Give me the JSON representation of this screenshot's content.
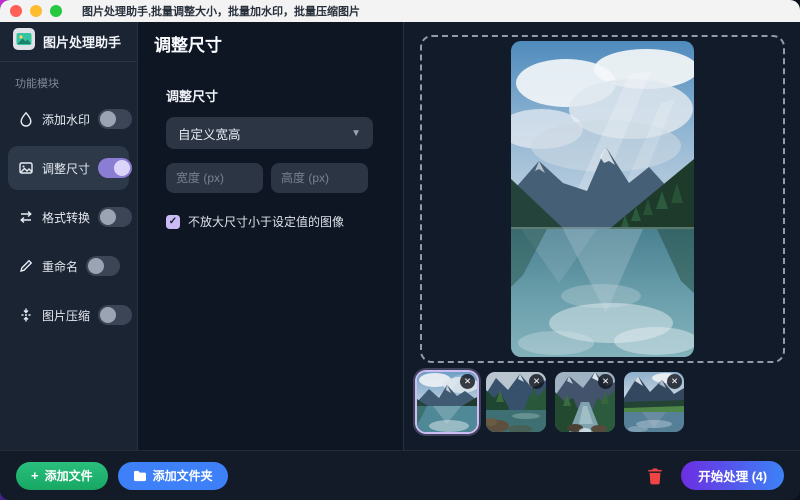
{
  "window": {
    "title": "图片处理助手,批量调整大小，批量加水印，批量压缩图片"
  },
  "sidebar": {
    "app_name": "图片处理助手",
    "section_label": "功能模块",
    "items": [
      {
        "label": "添加水印",
        "icon": "droplet-icon",
        "enabled": false
      },
      {
        "label": "调整尺寸",
        "icon": "image-icon",
        "enabled": true
      },
      {
        "label": "格式转换",
        "icon": "swap-arrows-icon",
        "enabled": false
      },
      {
        "label": "重命名",
        "icon": "pencil-icon",
        "enabled": false
      },
      {
        "label": "图片压缩",
        "icon": "compress-icon",
        "enabled": false
      }
    ]
  },
  "panel": {
    "header": "调整尺寸",
    "section_label": "调整尺寸",
    "mode_select": {
      "value": "自定义宽高",
      "icon": "chevron-down-icon"
    },
    "width_input": {
      "value": "",
      "placeholder": "宽度 (px)"
    },
    "height_input": {
      "value": "",
      "placeholder": "高度 (px)"
    },
    "checkbox": {
      "checked": true,
      "check_glyph": "✓",
      "label": "不放大尺寸小于设定值的图像"
    }
  },
  "preview": {
    "thumbnails": [
      {
        "name": "mountain-lake-blue",
        "selected": true,
        "close_glyph": "✕"
      },
      {
        "name": "forest-lake-green",
        "selected": false,
        "close_glyph": "✕"
      },
      {
        "name": "forest-stream",
        "selected": false,
        "close_glyph": "✕"
      },
      {
        "name": "meadow-lake",
        "selected": false,
        "close_glyph": "✕"
      }
    ]
  },
  "footer": {
    "add_files_label": "添加文件",
    "add_files_plus": "+",
    "add_folder_label": "添加文件夹",
    "start_label": "开始处理 (4)",
    "file_count": 4
  },
  "colors": {
    "accent_purple": "#897dd4",
    "checkbox_purple": "#c9bcf5",
    "selected_thumb_border": "#cdbdf5",
    "add_files_green": "#1fb573",
    "add_folder_blue": "#3d80f7",
    "delete_red": "#ef4444",
    "start_gradient_from": "#6c2ee2",
    "start_gradient_to": "#3c82f6",
    "traffic_red": "#ff5f57",
    "traffic_yellow": "#febc2e",
    "traffic_green": "#28c840"
  }
}
